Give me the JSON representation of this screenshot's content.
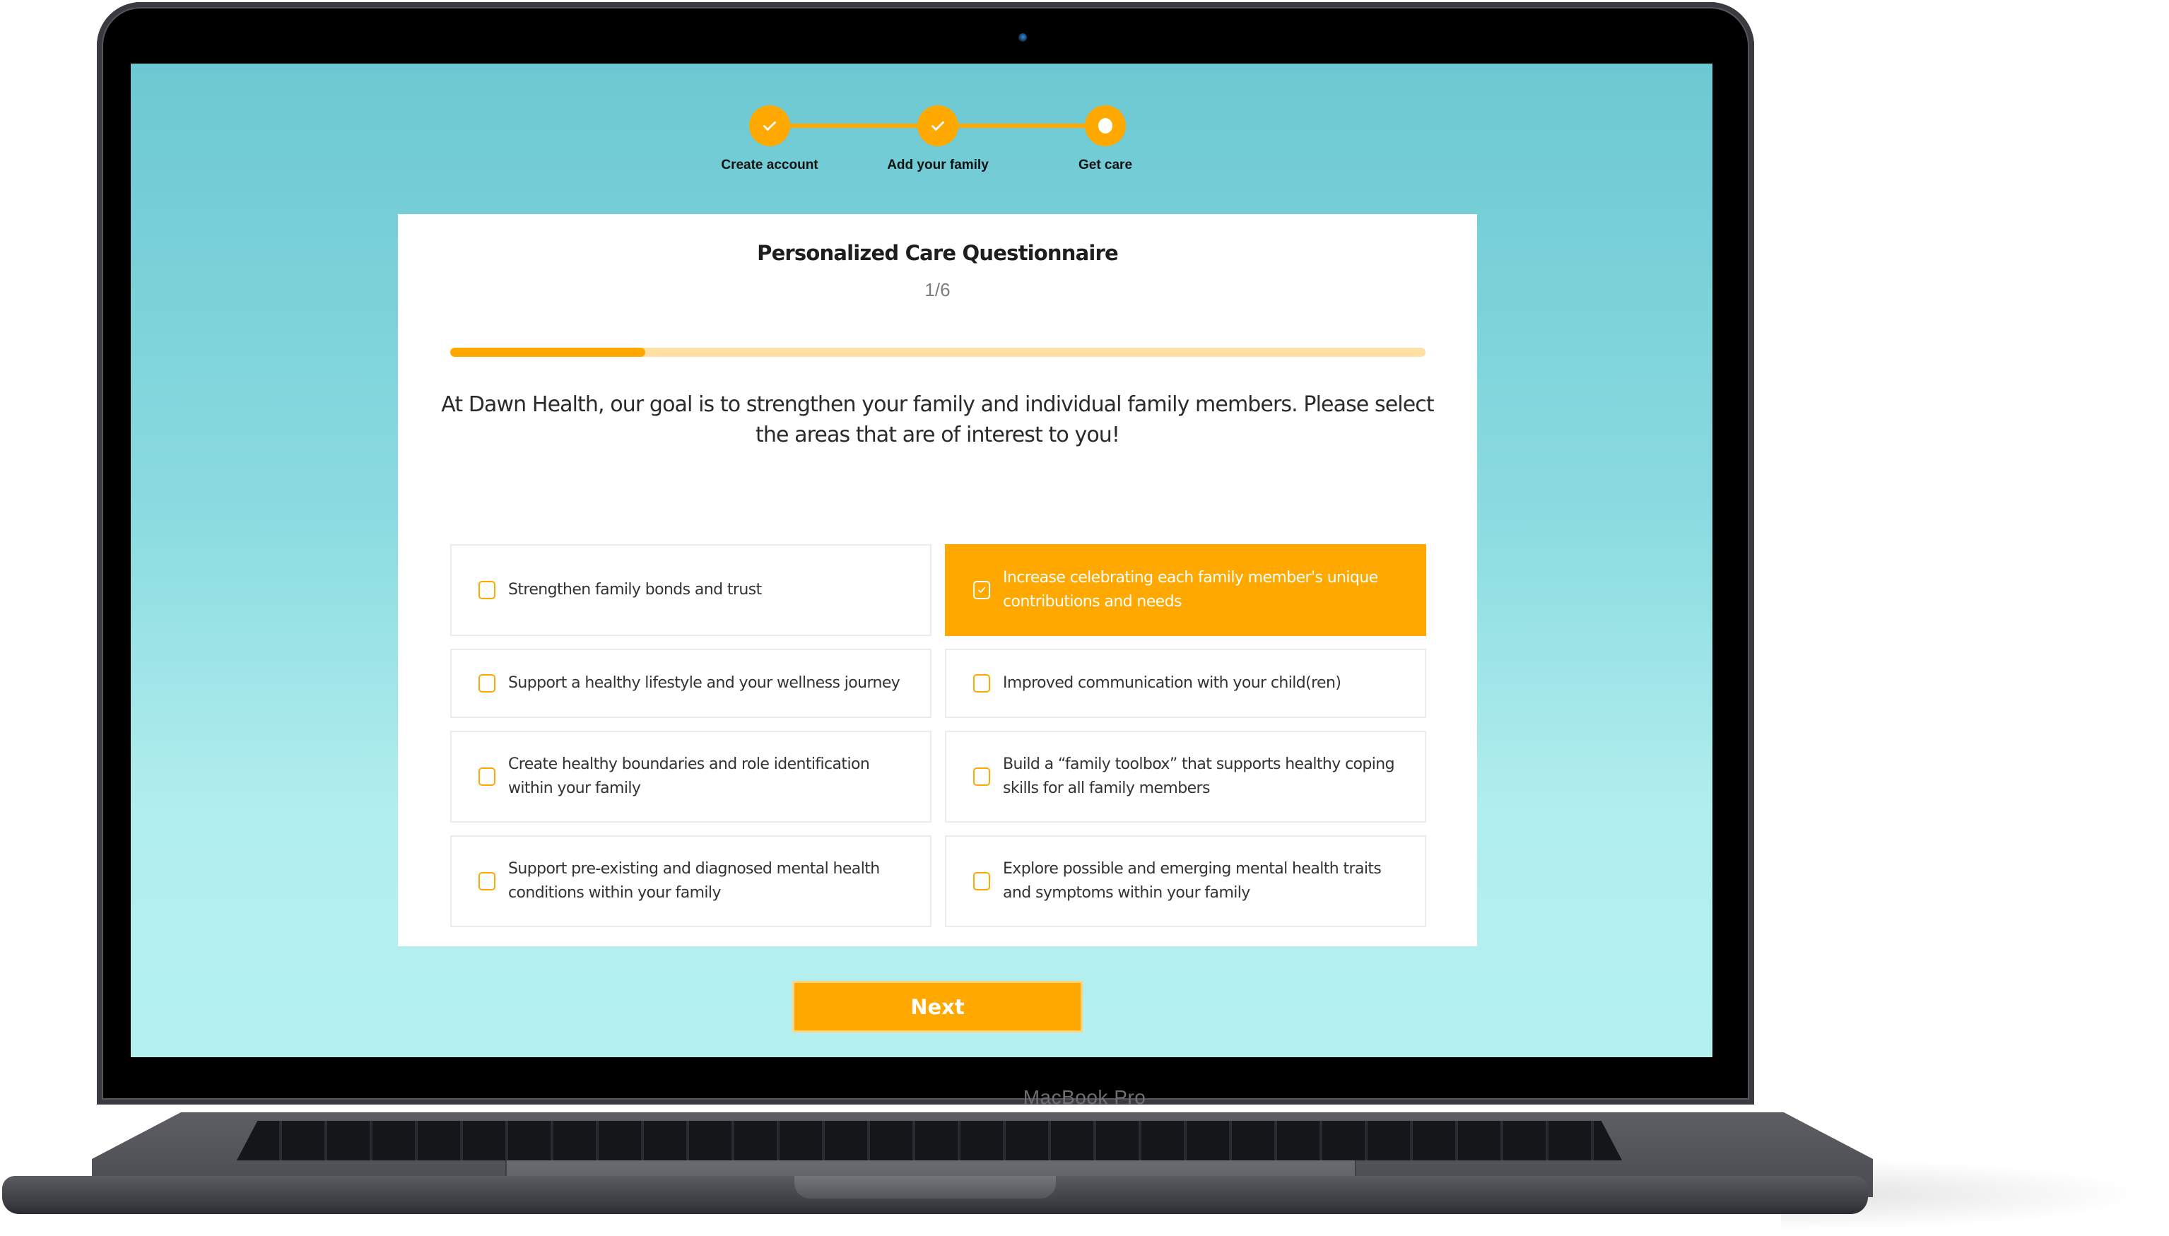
{
  "device": {
    "brand_label": "MacBook Pro"
  },
  "stepper": {
    "steps": [
      {
        "label": "Create account",
        "status": "completed",
        "icon": "check-icon"
      },
      {
        "label": "Add your family",
        "status": "completed",
        "icon": "check-icon"
      },
      {
        "label": "Get care",
        "status": "current",
        "icon": "dot-icon"
      }
    ]
  },
  "questionnaire": {
    "title": "Personalized Care Questionnaire",
    "step_counter": "1/6",
    "progress_fraction": 0.2,
    "question": "At Dawn Health, our goal is to strengthen your family and individual family members. Please select the areas that are of interest to you!",
    "options": [
      {
        "label": "Strengthen family bonds and trust",
        "checked": false
      },
      {
        "label": "Increase celebrating each family member's unique contributions and needs",
        "checked": true
      },
      {
        "label": "Support a healthy lifestyle and your wellness journey",
        "checked": false
      },
      {
        "label": "Improved communication with your child(ren)",
        "checked": false
      },
      {
        "label": "Create healthy boundaries and role identification within your family",
        "checked": false
      },
      {
        "label": "Build a “family toolbox” that supports healthy coping skills for all family members",
        "checked": false
      },
      {
        "label": "Support pre-existing and diagnosed mental health conditions within your family",
        "checked": false
      },
      {
        "label": "Explore possible and emerging mental health traits and symptoms within your family",
        "checked": false
      }
    ],
    "next_label": "Next"
  },
  "colors": {
    "accent": "#ffa800",
    "accent_light": "#ffe0a4",
    "background_top": "#6cc8d2",
    "background_bottom": "#b3f0ef"
  }
}
